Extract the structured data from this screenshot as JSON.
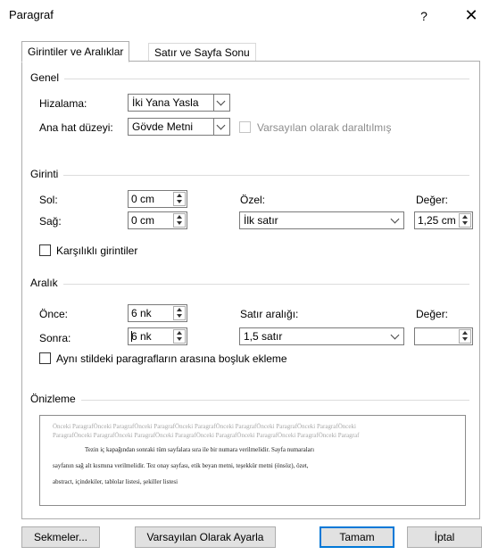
{
  "window": {
    "title": "Paragraf",
    "help_label": "?",
    "close_label": "✕"
  },
  "tabs": [
    {
      "label": "Girintiler ve Aralıklar",
      "active": true
    },
    {
      "label": "Satır ve Sayfa Sonu",
      "active": false
    }
  ],
  "general": {
    "legend": "Genel",
    "alignment_label": "Hizalama:",
    "alignment_value": "İki Yana Yasla",
    "outline_label": "Ana hat düzeyi:",
    "outline_value": "Gövde Metni",
    "collapsed_label": "Varsayılan olarak daraltılmış"
  },
  "indent": {
    "legend": "Girinti",
    "left_label": "Sol:",
    "left_value": "0 cm",
    "right_label": "Sağ:",
    "right_value": "0 cm",
    "special_label": "Özel:",
    "special_value": "İlk satır",
    "by_label": "Değer:",
    "by_value": "1,25 cm",
    "mirror_label": "Karşılıklı girintiler"
  },
  "spacing": {
    "legend": "Aralık",
    "before_label": "Önce:",
    "before_value": "6 nk",
    "after_label": "Sonra:",
    "after_value": "6 nk",
    "line_spacing_label": "Satır aralığı:",
    "line_spacing_value": "1,5 satır",
    "at_label": "Değer:",
    "at_value": "",
    "dont_add_label": "Aynı stildeki paragrafların arasına boşluk ekleme"
  },
  "preview": {
    "legend": "Önizleme",
    "prev_line1": "Önceki ParagrafÖnceki ParagrafÖnceki ParagrafÖnceki ParagrafÖnceki ParagrafÖnceki ParagrafÖnceki ParagrafÖnceki",
    "prev_line2": "ParagrafÖnceki ParagrafÖnceki ParagrafÖnceki ParagrafÖnceki ParagrafÖnceki ParagrafÖnceki ParagrafÖnceki Paragraf",
    "text_line1": "Tezin iç kapağından sonraki tüm sayfalara sıra ile bir numara verilmelidir. Sayfa numaraları",
    "text_line2": "sayfanın sağ alt kısmına verilmelidir. Tez onay sayfası, etik beyan metni, teşekkür metni (önsöz), özet,",
    "text_line3": "abstract, içindekiler, tablolar listesi, şekiller listesi"
  },
  "buttons": {
    "tabs_label": "Sekmeler...",
    "default_label": "Varsayılan Olarak Ayarla",
    "ok_label": "Tamam",
    "cancel_label": "İptal"
  }
}
